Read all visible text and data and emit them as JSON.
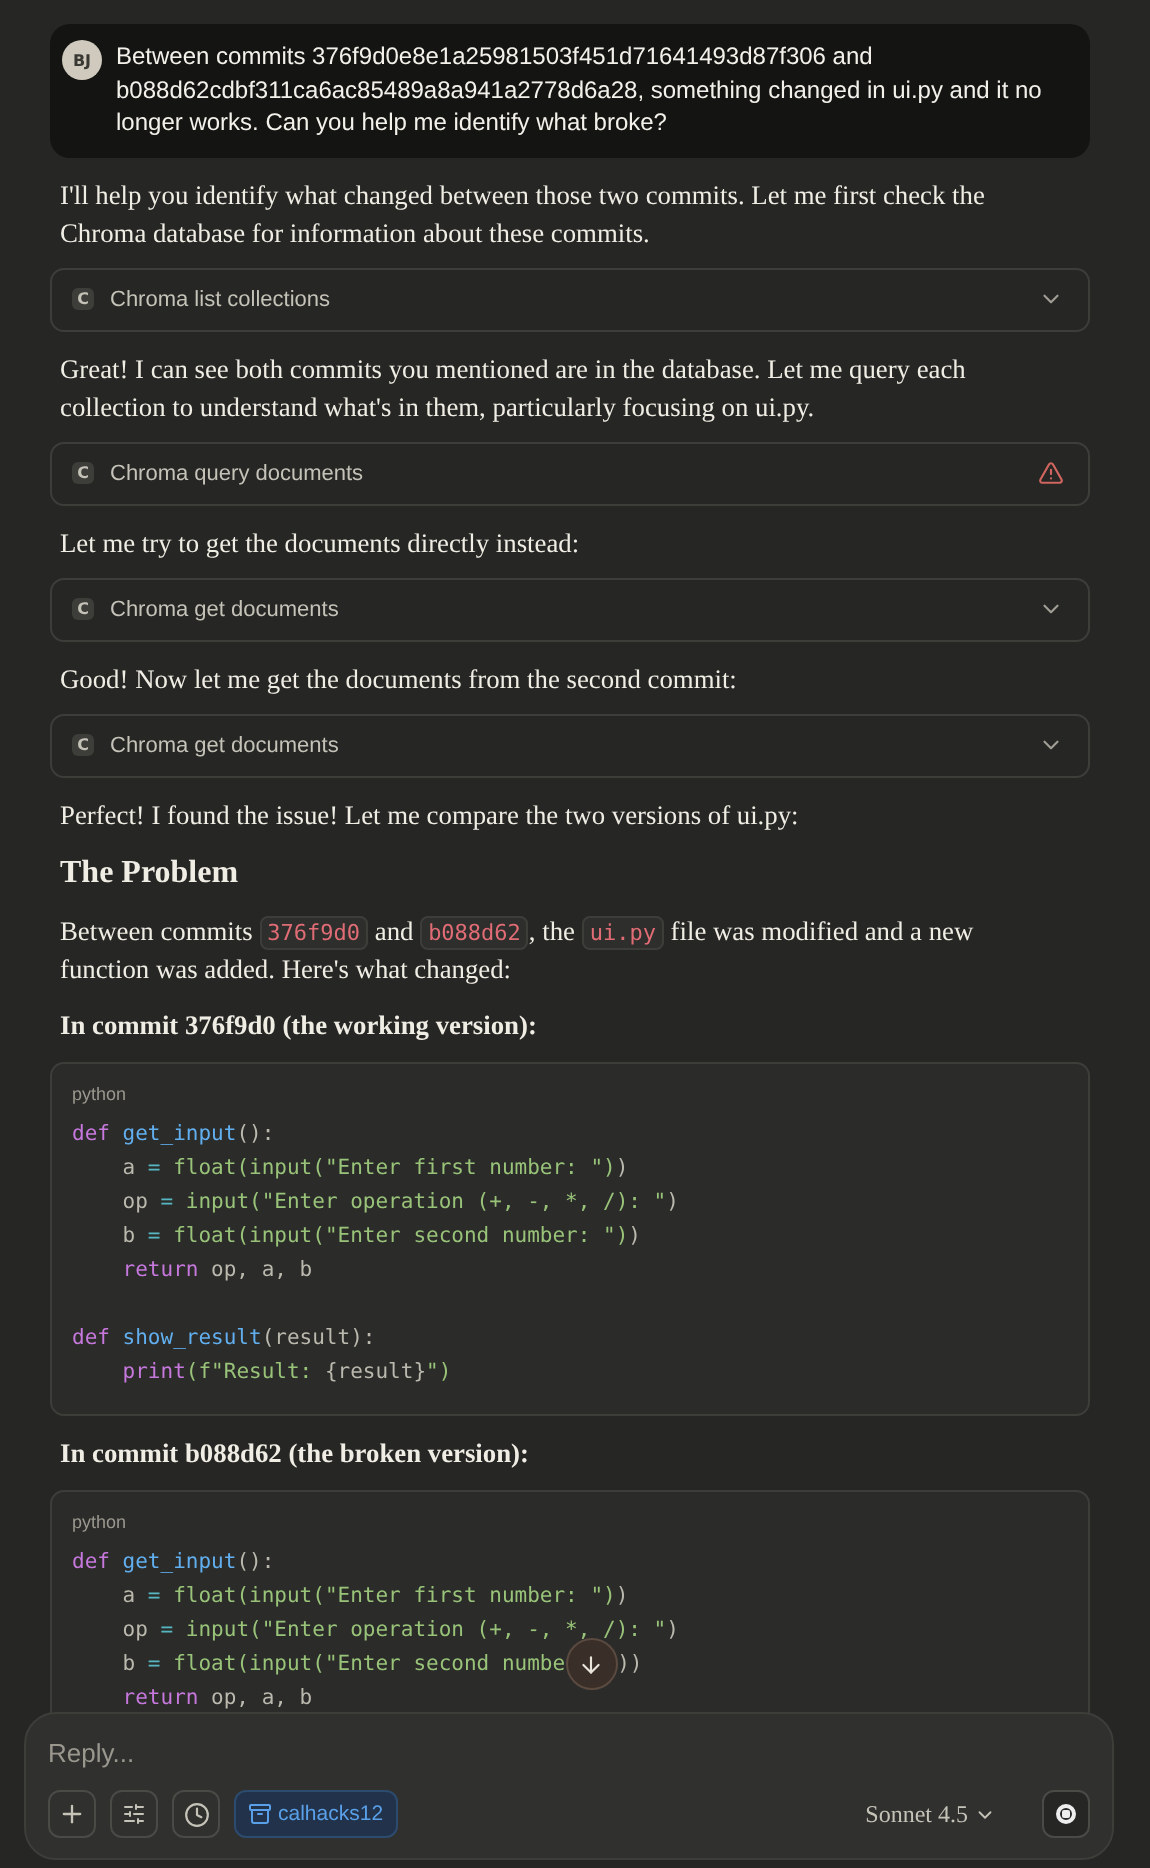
{
  "user_message": {
    "avatar": "BJ",
    "text": "Between commits 376f9d0e8e1a25981503f451d71641493d87f306 and b088d62cdbf311ca6ac85489a8a941a2778d6a28, something changed in ui.py and it no longer works. Can you help me identify what broke?"
  },
  "blocks": [
    {
      "kind": "text",
      "text": "I'll help you identify what changed between those two commits. Let me first check the Chroma database for information about these commits."
    },
    {
      "kind": "tool",
      "badge": "C",
      "label": "Chroma list collections",
      "error": false
    },
    {
      "kind": "text",
      "text": "Great! I can see both commits you mentioned are in the database. Let me query each collection to understand what's in them, particularly focusing on ui.py."
    },
    {
      "kind": "tool",
      "badge": "C",
      "label": "Chroma query documents",
      "error": true
    },
    {
      "kind": "text",
      "text": "Let me try to get the documents directly instead:"
    },
    {
      "kind": "tool",
      "badge": "C",
      "label": "Chroma get documents",
      "error": false
    },
    {
      "kind": "text",
      "text": "Good! Now let me get the documents from the second commit:"
    },
    {
      "kind": "tool",
      "badge": "C",
      "label": "Chroma get documents",
      "error": false
    },
    {
      "kind": "text",
      "text": "Perfect! I found the issue! Let me compare the two versions of ui.py:"
    },
    {
      "kind": "heading",
      "text": "The Problem"
    },
    {
      "kind": "rich",
      "segments": [
        {
          "text": "Between commits "
        },
        {
          "code": "376f9d0"
        },
        {
          "text": " and "
        },
        {
          "code": "b088d62"
        },
        {
          "text": ", the "
        },
        {
          "code": "ui.py"
        },
        {
          "text": " file was modified and a new function was added. Here's what changed:"
        }
      ]
    },
    {
      "kind": "subheading",
      "text": "In commit 376f9d0 (the working version):"
    },
    {
      "kind": "code",
      "language": "python",
      "lines": [
        {
          "tokens": [
            {
              "t": "def",
              "kind": "keyword"
            },
            {
              "t": " get_input",
              "kind": "function"
            },
            {
              "t": "():",
              "kind": "plain"
            }
          ]
        },
        {
          "tokens": [
            {
              "t": "    a",
              "kind": "plain"
            },
            {
              "t": " =",
              "kind": "operator"
            },
            {
              "t": " float(input(\"Enter first number: \")",
              "kind": "string"
            },
            {
              "t": ")",
              "kind": "plain"
            }
          ]
        },
        {
          "tokens": [
            {
              "t": "    op",
              "kind": "plain"
            },
            {
              "t": " =",
              "kind": "operator"
            },
            {
              "t": " input(\"Enter operation (+, -, *, /): \"",
              "kind": "string"
            },
            {
              "t": ")",
              "kind": "plain"
            }
          ]
        },
        {
          "tokens": [
            {
              "t": "    b",
              "kind": "plain"
            },
            {
              "t": " =",
              "kind": "operator"
            },
            {
              "t": " float(input(\"Enter second number: \")",
              "kind": "string"
            },
            {
              "t": ")",
              "kind": "plain"
            }
          ]
        },
        {
          "tokens": [
            {
              "t": "    return",
              "kind": "keyword"
            },
            {
              "t": " op, a, b",
              "kind": "plain"
            }
          ]
        },
        {
          "blank": true
        },
        {
          "tokens": [
            {
              "t": "def",
              "kind": "keyword"
            },
            {
              "t": " show_result",
              "kind": "function"
            },
            {
              "t": "(result):",
              "kind": "plain"
            }
          ]
        },
        {
          "tokens": [
            {
              "t": "    print",
              "kind": "keyword"
            },
            {
              "t": "(f\"Result: ",
              "kind": "string"
            },
            {
              "t": "{result}",
              "kind": "plain"
            },
            {
              "t": "\")",
              "kind": "string"
            }
          ]
        }
      ]
    },
    {
      "kind": "subheading",
      "text": "In commit b088d62 (the broken version):"
    },
    {
      "kind": "code",
      "language": "python",
      "lines": [
        {
          "tokens": [
            {
              "t": "def",
              "kind": "keyword"
            },
            {
              "t": " get_input",
              "kind": "function"
            },
            {
              "t": "():",
              "kind": "plain"
            }
          ]
        },
        {
          "tokens": [
            {
              "t": "    a",
              "kind": "plain"
            },
            {
              "t": " =",
              "kind": "operator"
            },
            {
              "t": " float(input(\"Enter first number: \")",
              "kind": "string"
            },
            {
              "t": ")",
              "kind": "plain"
            }
          ]
        },
        {
          "tokens": [
            {
              "t": "    op",
              "kind": "plain"
            },
            {
              "t": " =",
              "kind": "operator"
            },
            {
              "t": " input(\"Enter operation (+, -, *, /): \"",
              "kind": "string"
            },
            {
              "t": ")",
              "kind": "plain"
            }
          ]
        },
        {
          "tokens": [
            {
              "t": "    b",
              "kind": "plain"
            },
            {
              "t": " =",
              "kind": "operator"
            },
            {
              "t": " float(input(\"Enter second numbe",
              "kind": "string"
            }
          ],
          "after_scroll_button": [
            {
              "t": "))",
              "kind": "plain"
            }
          ]
        },
        {
          "tokens": [
            {
              "t": "    return",
              "kind": "keyword"
            },
            {
              "t": " op, a, b",
              "kind": "plain"
            }
          ]
        }
      ]
    }
  ],
  "composer": {
    "placeholder": "Reply...",
    "project": "calhacks12",
    "model": "Sonnet 4.5"
  }
}
